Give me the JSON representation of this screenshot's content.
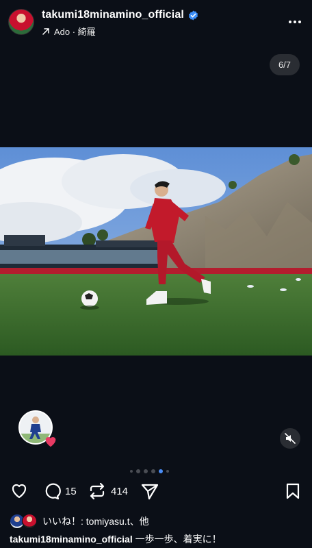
{
  "header": {
    "username": "takumi18minamino_official",
    "music": "Ado · 綺羅"
  },
  "carousel": {
    "counter": "6/7",
    "total_dots": 7,
    "active_dot": 5
  },
  "actions": {
    "comments_count": "15",
    "reposts_count": "414"
  },
  "likes": {
    "text": "いいね！: tomiyasu.t、他"
  },
  "caption": {
    "username": "takumi18minamino_official",
    "text": "一歩一歩、着実に！"
  },
  "colors": {
    "background": "#0b0f17",
    "accent": "#4a8df6",
    "verified": "#3d8ef7",
    "heart": "#e83a63"
  },
  "icons": [
    "verified-icon",
    "repost-arrow-icon",
    "more-icon",
    "heart-icon",
    "comment-icon",
    "repost-icon",
    "send-icon",
    "bookmark-icon",
    "mute-icon"
  ]
}
